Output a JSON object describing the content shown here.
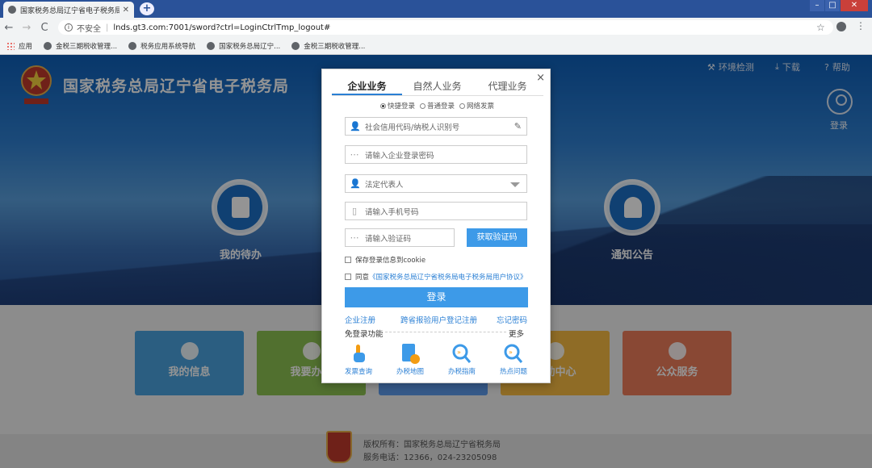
{
  "browser": {
    "tab_title": "国家税务总局辽宁省电子税务局",
    "tab_close": "✕",
    "new_tab": "+",
    "window_title": "",
    "nav_back": "←",
    "nav_forward": "→",
    "nav_reload": "C",
    "security_label": "不安全",
    "url": "lnds.gt3.com:7001/sword?ctrl=LoginCtrlTmp_logout#",
    "bookmarks": [
      "应用",
      "金税三期税收管理...",
      "税务应用系统导航",
      "国家税务总局辽宁...",
      "金税三期税收管理..."
    ]
  },
  "header": {
    "site_title": "国家税务总局辽宁省电子税务局",
    "env_check": "环境检测",
    "download": "下载",
    "help": "帮助",
    "login": "登录"
  },
  "hero": {
    "left_label": "我的待办",
    "right_label": "通知公告"
  },
  "tiles": [
    {
      "label": "我的信息",
      "color": "#4aa3df"
    },
    {
      "label": "我要办税",
      "color": "#8cc152"
    },
    {
      "label": "",
      "color": "#5d9cec"
    },
    {
      "label": "互动中心",
      "color": "#f6bb42"
    },
    {
      "label": "公众服务",
      "color": "#ed7d5a"
    }
  ],
  "footer": {
    "copyright": "版权所有：国家税务总局辽宁省税务局",
    "service": "服务电话：12366，024-23205098"
  },
  "modal": {
    "close": "×",
    "tabs": [
      "企业业务",
      "自然人业务",
      "代理业务"
    ],
    "active_tab": "企业业务",
    "login_modes": [
      "快捷登录",
      "普通登录",
      "网络发票"
    ],
    "fields": {
      "credit_code": "社会信用代码/纳税人识别号",
      "password": "请输入企业登录密码",
      "legal_rep": "法定代表人",
      "phone": "请输入手机号码",
      "captcha": "请输入验证码"
    },
    "get_code_button": "获取验证码",
    "save_cookie": "保存登录信息到cookie",
    "agree_prefix": "同意",
    "agree_link": "《国家税务总局辽宁省税务局电子税务局用户协议》",
    "login_button": "登录",
    "links": [
      "企业注册",
      "跨省报验用户登记注册",
      "忘记密码"
    ],
    "nologin_title": "免登录功能",
    "more": "更多",
    "quick_actions": [
      "发票查询",
      "办税地图",
      "办税指南",
      "热点问题"
    ]
  },
  "colors": {
    "accent": "#3d9ae8",
    "link": "#2a7fd4",
    "browser_tabbar": "#2a5299"
  }
}
